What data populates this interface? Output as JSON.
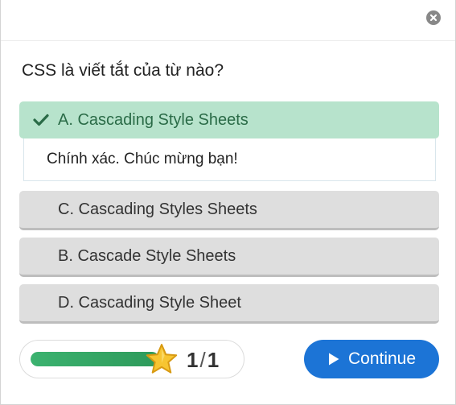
{
  "question": {
    "text": "CSS là viết tắt của từ nào?"
  },
  "options": [
    {
      "label": "A. Cascading Style Sheets",
      "state": "correct"
    },
    {
      "label": "C. Cascading Styles Sheets",
      "state": "default"
    },
    {
      "label": "B. Cascade Style Sheets",
      "state": "default"
    },
    {
      "label": "D. Cascading Style Sheet",
      "state": "default"
    }
  ],
  "feedback": {
    "text": "Chính xác. Chúc mừng bạn!"
  },
  "progress": {
    "fraction": 1.0,
    "current": "1",
    "separator": "/",
    "total": "1"
  },
  "actions": {
    "continue_label": "Continue"
  },
  "colors": {
    "correct_bg": "#b7e3cc",
    "correct_text": "#2a6b47",
    "option_bg": "#dedede",
    "progress_fill": "#3bb26f",
    "continue_bg": "#1c74d6"
  },
  "icons": {
    "close": "close-icon",
    "check": "check-icon",
    "star": "star-icon",
    "play": "play-icon"
  }
}
